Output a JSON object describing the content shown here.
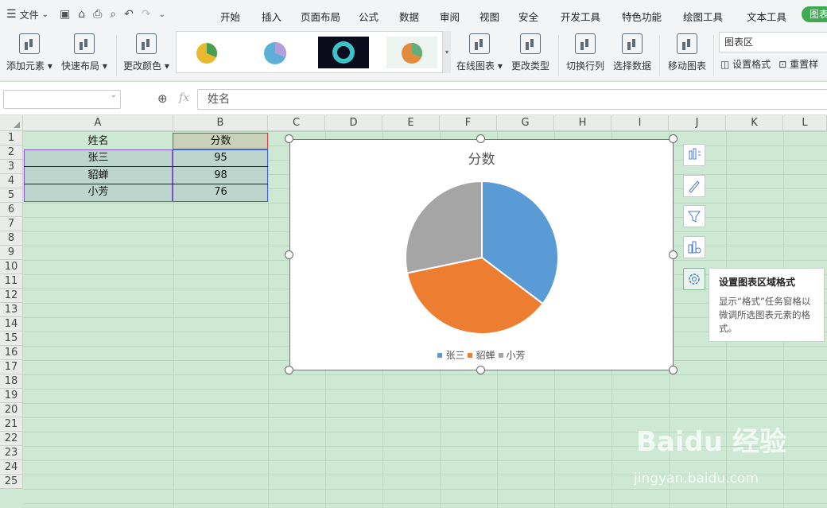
{
  "menubar": {
    "file": "文件",
    "tabs": [
      "开始",
      "插入",
      "页面布局",
      "公式",
      "数据",
      "审阅",
      "视图",
      "安全",
      "开发工具",
      "特色功能",
      "绘图工具",
      "文本工具"
    ],
    "active_tab": "图表"
  },
  "ribbon": {
    "add_element": "添加元素",
    "quick_layout": "快速布局",
    "change_color": "更改颜色",
    "online_chart": "在线图表",
    "change_type": "更改类型",
    "switch_rowcol": "切换行列",
    "select_data": "选择数据",
    "move_chart": "移动图表",
    "area_select": "图表区",
    "set_format": "设置格式",
    "reset_style": "重置样"
  },
  "formula": {
    "name_box": "",
    "content": "姓名"
  },
  "columns": [
    "A",
    "B",
    "C",
    "D",
    "E",
    "F",
    "G",
    "H",
    "I",
    "J",
    "K",
    "L"
  ],
  "rows": [
    "1",
    "2",
    "3",
    "4",
    "5",
    "6",
    "7",
    "8",
    "9",
    "10",
    "11",
    "12",
    "13",
    "14",
    "15",
    "16",
    "17",
    "18",
    "19",
    "20",
    "21",
    "22",
    "23",
    "24",
    "25"
  ],
  "table": {
    "headers": [
      "姓名",
      "分数"
    ],
    "rows": [
      [
        "张三",
        "95"
      ],
      [
        "貂蝉",
        "98"
      ],
      [
        "小芳",
        "76"
      ]
    ]
  },
  "tooltip": {
    "title": "设置图表区域格式",
    "body": "显示“格式”任务窗格以微调所选图表元素的格式。"
  },
  "watermark": {
    "main": "Baidu 经验",
    "sub": "jingyan.baidu.com"
  },
  "colors": {
    "accent": "#3cab52",
    "series": [
      "#5b9bd5",
      "#ed7d31",
      "#a5a5a5"
    ]
  },
  "chart_data": {
    "type": "pie",
    "title": "分数",
    "categories": [
      "张三",
      "貂蝉",
      "小芳"
    ],
    "values": [
      95,
      98,
      76
    ],
    "legend": "bottom"
  }
}
